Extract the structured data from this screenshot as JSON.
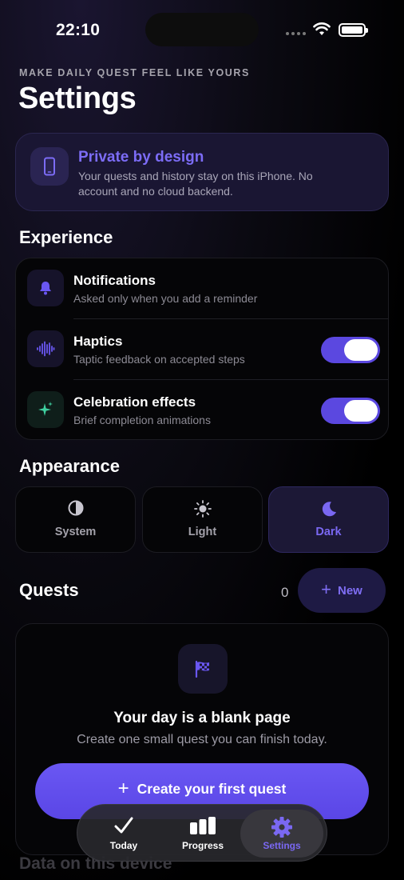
{
  "status_bar": {
    "time": "22:10"
  },
  "header": {
    "eyebrow": "MAKE DAILY QUEST FEEL LIKE YOURS",
    "title": "Settings"
  },
  "privacy": {
    "title": "Private by design",
    "description": "Your quests and history stay on this iPhone. No account and no cloud backend."
  },
  "experience": {
    "title": "Experience",
    "items": [
      {
        "label": "Notifications",
        "sub": "Asked only when you add a reminder",
        "icon": "bell-icon"
      },
      {
        "label": "Haptics",
        "sub": "Taptic feedback on accepted steps",
        "icon": "waveform-icon",
        "toggle_on": true
      },
      {
        "label": "Celebration effects",
        "sub": "Brief completion animations",
        "icon": "sparkles-icon",
        "toggle_on": true
      }
    ]
  },
  "appearance": {
    "title": "Appearance",
    "options": [
      {
        "label": "System",
        "icon": "circle-half-icon",
        "selected": false
      },
      {
        "label": "Light",
        "icon": "sun-icon",
        "selected": false
      },
      {
        "label": "Dark",
        "icon": "moon-icon",
        "selected": true
      }
    ]
  },
  "quests": {
    "title": "Quests",
    "count": "0",
    "new_label": "New",
    "empty_title": "Your day is a blank page",
    "empty_sub": "Create one small quest you can finish today.",
    "create_label": "Create your first quest"
  },
  "data_section": {
    "title": "Data on this device"
  },
  "tab_bar": {
    "tabs": [
      {
        "label": "Today",
        "icon": "checkmark-icon",
        "active": false
      },
      {
        "label": "Progress",
        "icon": "bar-chart-icon",
        "active": false
      },
      {
        "label": "Settings",
        "icon": "gear-icon",
        "active": true
      }
    ]
  },
  "colors": {
    "accent": "#6a57f3",
    "accent_text": "#7c6cf6",
    "background": "#000000",
    "card": "#050507"
  }
}
